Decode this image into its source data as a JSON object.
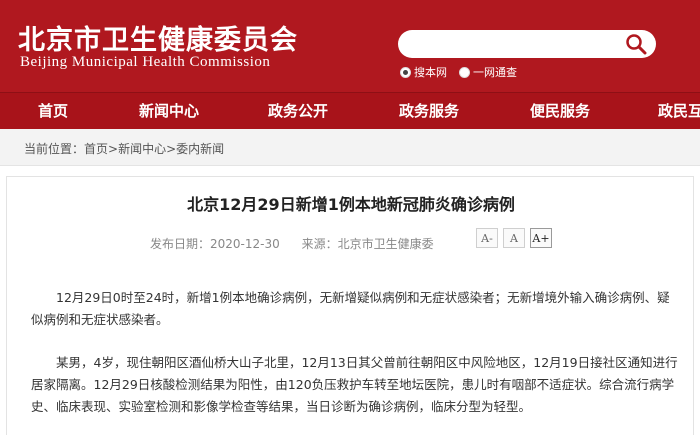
{
  "header": {
    "title_cn": "北京市卫生健康委员会",
    "title_en": "Beijing Municipal Health Commission",
    "search": {
      "placeholder": ""
    },
    "radio_options": [
      {
        "label": "搜本网",
        "checked": true
      },
      {
        "label": "一网通查",
        "checked": false
      }
    ]
  },
  "nav": {
    "items": [
      "首页",
      "新闻中心",
      "政务公开",
      "政务服务",
      "便民服务",
      "政民互"
    ]
  },
  "breadcrumb": {
    "prefix": "当前位置：",
    "items": [
      "首页",
      "新闻中心",
      "委内新闻"
    ],
    "separator": ">"
  },
  "article": {
    "title": "北京12月29日新增1例本地新冠肺炎确诊病例",
    "date_label": "发布日期：2020-12-30",
    "source_label": "来源：北京市卫生健康委",
    "font_size_buttons": [
      "A-",
      "A",
      "A+"
    ],
    "paragraphs": [
      "12月29日0时至24时，新增1例本地确诊病例，无新增疑似病例和无症状感染者；无新增境外输入确诊病例、疑似病例和无症状感染者。",
      "某男，4岁，现住朝阳区酒仙桥大山子北里，12月13日其父曾前往朝阳区中风险地区，12月19日接社区通知进行居家隔离。12月29日核酸检测结果为阳性，由120负压救护车转至地坛医院，患儿时有咽部不适症状。综合流行病学史、临床表现、实验室检测和影像学检查等结果，当日诊断为确诊病例，临床分型为轻型。"
    ]
  },
  "colors": {
    "header_red": "#b0181f",
    "nav_red": "#a8131a",
    "crumb_bg": "#f3f3f3"
  }
}
